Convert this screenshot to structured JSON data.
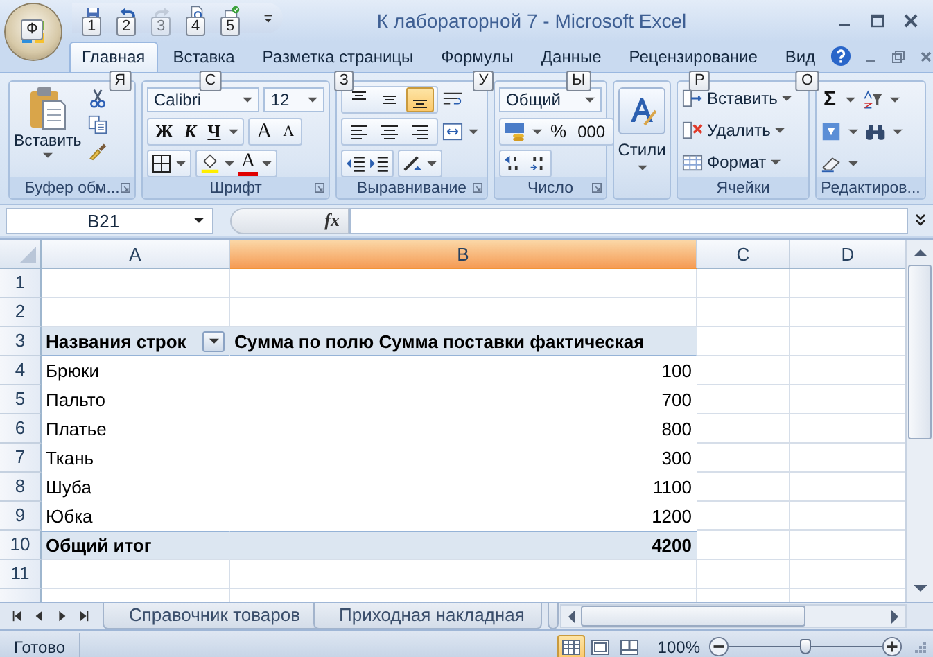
{
  "app_button": {
    "keytip": "Ф"
  },
  "quick_access": [
    {
      "kind": "save",
      "keytip": "1",
      "disabled": false
    },
    {
      "kind": "undo",
      "keytip": "2",
      "disabled": false
    },
    {
      "kind": "redo",
      "keytip": "3",
      "disabled": true
    },
    {
      "kind": "preview",
      "keytip": "4",
      "disabled": false
    },
    {
      "kind": "check",
      "keytip": "5",
      "disabled": false
    }
  ],
  "window": {
    "title": "К лабораторной 7 - Microsoft Excel"
  },
  "tabs": [
    {
      "label": "Главная",
      "keytip": "Я",
      "selected": true
    },
    {
      "label": "Вставка",
      "keytip": "С",
      "selected": false
    },
    {
      "label": "Разметка страницы",
      "keytip": "З",
      "selected": false
    },
    {
      "label": "Формулы",
      "keytip": "У",
      "selected": false
    },
    {
      "label": "Данные",
      "keytip": "Ы",
      "selected": false
    },
    {
      "label": "Рецензирование",
      "keytip": "Р",
      "selected": false
    },
    {
      "label": "Вид",
      "keytip": "О",
      "selected": false
    }
  ],
  "ribbon": {
    "clipboard": {
      "label": "Буфер обм...",
      "paste": "Вставить"
    },
    "font": {
      "label": "Шрифт",
      "font": "Calibri",
      "size": "12",
      "bold": "Ж",
      "italic": "К",
      "underline": "Ч",
      "grow": "A",
      "shrink": "A",
      "tint_label": "A"
    },
    "alignment": {
      "label": "Выравнивание",
      "vertical": [
        {
          "kind": "top",
          "selected": false
        },
        {
          "kind": "middle",
          "selected": false
        },
        {
          "kind": "bottom",
          "selected": true
        }
      ],
      "horizontal": [
        {
          "kind": "left",
          "selected": false
        },
        {
          "kind": "center",
          "selected": false
        },
        {
          "kind": "right",
          "selected": false
        }
      ]
    },
    "number": {
      "label": "Число",
      "format": "Общий",
      "percent": "%",
      "thousands": "000"
    },
    "styles": {
      "label": "Стили"
    },
    "cells": {
      "label": "Ячейки",
      "buttons": [
        {
          "kind": "insert",
          "label": "Вставить"
        },
        {
          "kind": "delete",
          "label": "Удалить"
        },
        {
          "kind": "format",
          "label": "Формат"
        }
      ]
    },
    "editing": {
      "label": "Редактиров...",
      "sum": "Σ"
    }
  },
  "formula_bar": {
    "name_box": "B21",
    "fx": "fx"
  },
  "columns": [
    {
      "label": "A",
      "selected": false
    },
    {
      "label": "B",
      "selected": true
    },
    {
      "label": "C",
      "selected": false
    },
    {
      "label": "D",
      "selected": false
    }
  ],
  "rows": [
    {
      "number": "1",
      "kind": "empty"
    },
    {
      "number": "2",
      "kind": "empty"
    },
    {
      "number": "3",
      "kind": "header",
      "a": "Названия строк",
      "b": "Сумма по полю Сумма поставки фактическая"
    },
    {
      "number": "4",
      "kind": "item",
      "a": "Брюки",
      "b": "100"
    },
    {
      "number": "5",
      "kind": "item",
      "a": "Пальто",
      "b": "700"
    },
    {
      "number": "6",
      "kind": "item",
      "a": "Платье",
      "b": "800"
    },
    {
      "number": "7",
      "kind": "item",
      "a": "Ткань",
      "b": "300"
    },
    {
      "number": "8",
      "kind": "item",
      "a": "Шуба",
      "b": "1100"
    },
    {
      "number": "9",
      "kind": "item",
      "a": "Юбка",
      "b": "1200"
    },
    {
      "number": "10",
      "kind": "total",
      "a": "Общий итог",
      "b": "4200"
    },
    {
      "number": "11",
      "kind": "empty"
    }
  ],
  "sheet_tabs": [
    {
      "label": "Справочник товаров",
      "selected": false
    },
    {
      "label": "Приходная накладная",
      "selected": false
    }
  ],
  "status_bar": {
    "text": "Готово",
    "zoom": "100%",
    "zoom_slider": {
      "level": 0.5
    },
    "views": [
      {
        "kind": "normal",
        "selected": true
      },
      {
        "kind": "layout",
        "selected": false
      },
      {
        "kind": "break",
        "selected": false
      }
    ]
  }
}
